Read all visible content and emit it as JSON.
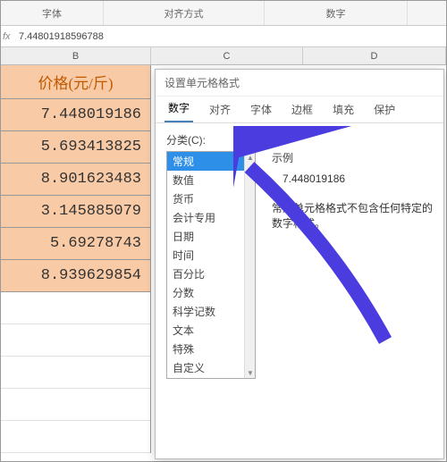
{
  "ribbon": {
    "font": "字体",
    "align": "对齐方式",
    "number": "数字"
  },
  "formula": {
    "fx": "fx",
    "value": "7.44801918596788"
  },
  "columns": {
    "b": "B",
    "c": "C",
    "d": "D"
  },
  "sheet": {
    "header": "价格(元/斤)",
    "rows": [
      "7.448019186",
      "5.693413825",
      "8.901623483",
      "3.145885079",
      "5.69278743",
      "8.939629854"
    ]
  },
  "dialog": {
    "title": "设置单元格格式",
    "tabs": [
      "数字",
      "对齐",
      "字体",
      "边框",
      "填充",
      "保护"
    ],
    "active_tab": 0,
    "category_label": "分类(C):",
    "categories": [
      "常规",
      "数值",
      "货币",
      "会计专用",
      "日期",
      "时间",
      "百分比",
      "分数",
      "科学记数",
      "文本",
      "特殊",
      "自定义"
    ],
    "selected_category": 0,
    "sample_label": "示例",
    "sample_value": "7.448019186",
    "description": "常规单元格格式不包含任何特定的数字格式。"
  }
}
